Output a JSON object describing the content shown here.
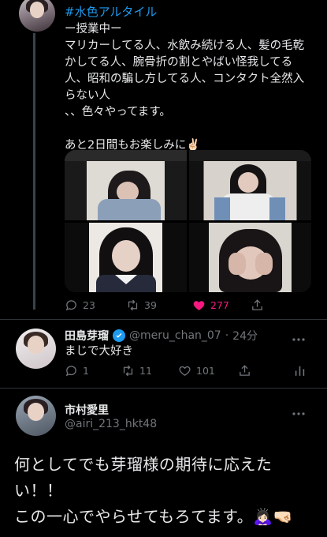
{
  "tweet": {
    "hashtag": "#水色アルタイル",
    "body": "ー授業中ー\nマリカーしてる人、水飲み続ける人、髪の毛乾かしてる人、腕骨折の割とやばい怪我してる人、昭和の騙し方してる人、コンタクト全然入らない人\n、、色々やってます。\n\nあと2日間もお楽しみに✌🏻",
    "actions": {
      "replies": "23",
      "retweets": "39",
      "likes": "277"
    },
    "like_color": "#f91880"
  },
  "reply1": {
    "name": "田島芽瑠",
    "handle": "@meru_chan_07",
    "time": "24分",
    "text": "まじで大好き",
    "actions": {
      "replies": "1",
      "retweets": "11",
      "likes": "101"
    }
  },
  "reply2": {
    "name": "市村愛里",
    "handle": "@airi_213_hkt48",
    "text": "何としてでも芽瑠様の期待に応えたい！！\nこの一心でやらせてもろてます。🙇🏻‍♀️🤜🏻"
  },
  "icons": {
    "reply": "reply-icon",
    "retweet": "retweet-icon",
    "like": "heart-icon",
    "share": "share-icon",
    "analytics": "analytics-icon",
    "more": "more-icon",
    "verified": "verified-badge-icon"
  },
  "colors": {
    "accent": "#1d9bf0",
    "text": "#e7e9ea",
    "muted": "#71767b",
    "background": "#000000"
  }
}
